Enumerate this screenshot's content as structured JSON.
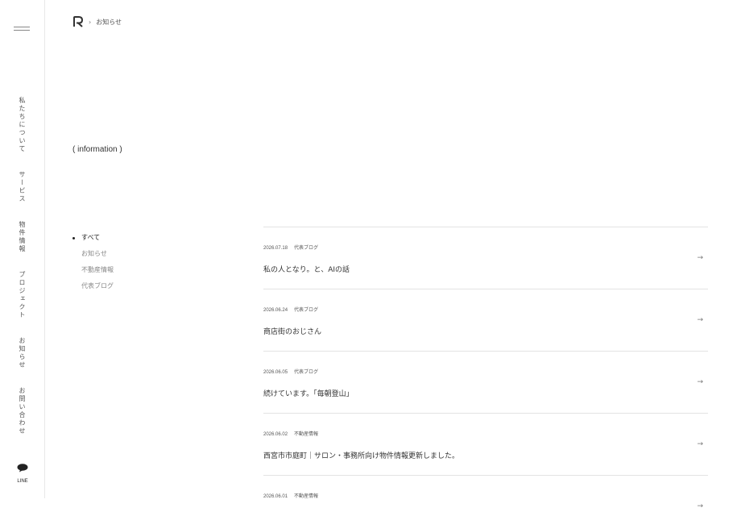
{
  "sidebar": {
    "nav": [
      {
        "label": "私たちについて"
      },
      {
        "label": "サービス"
      },
      {
        "label": "物件情報"
      },
      {
        "label": "プロジェクト"
      },
      {
        "label": "お知らせ"
      },
      {
        "label": "お問い合わせ"
      }
    ],
    "line_label": "LINE"
  },
  "breadcrumb": {
    "separator": "›",
    "current": "お知らせ"
  },
  "section_title": "( information )",
  "categories": [
    {
      "label": "すべて",
      "active": true
    },
    {
      "label": "お知らせ",
      "active": false
    },
    {
      "label": "不動産情報",
      "active": false
    },
    {
      "label": "代表ブログ",
      "active": false
    }
  ],
  "posts": [
    {
      "date": "2026.07.18",
      "category": "代表ブログ",
      "title": "私の人となり。と、AIの話",
      "arrow": "→"
    },
    {
      "date": "2026.06.24",
      "category": "代表ブログ",
      "title": "商店街のおじさん",
      "arrow": "→"
    },
    {
      "date": "2026.06.05",
      "category": "代表ブログ",
      "title": "続けています。「毎朝登山」",
      "arrow": "→"
    },
    {
      "date": "2026.06.02",
      "category": "不動産情報",
      "title": "西宮市市庭町｜サロン・事務所向け物件情報更新しました。",
      "arrow": "→"
    },
    {
      "date": "2026.06.01",
      "category": "不動産情報",
      "title": "",
      "arrow": "→"
    }
  ]
}
